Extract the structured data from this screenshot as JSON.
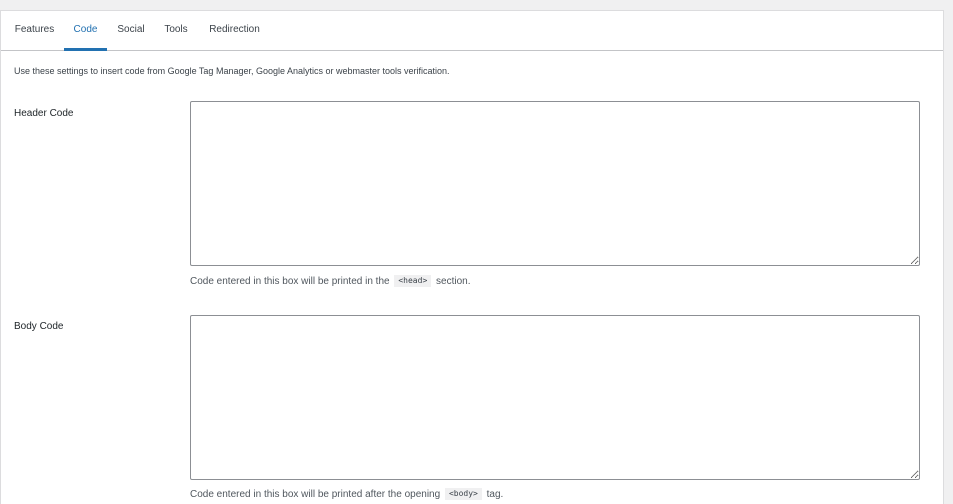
{
  "tabs": [
    {
      "label": "Features",
      "active": false
    },
    {
      "label": "Code",
      "active": true
    },
    {
      "label": "Social",
      "active": false
    },
    {
      "label": "Tools",
      "active": false
    },
    {
      "label": "Redirection",
      "active": false
    }
  ],
  "intro_text": "Use these settings to insert code from Google Tag Manager, Google Analytics or webmaster tools verification.",
  "header_code": {
    "label": "Header Code",
    "value": "",
    "description_before": "Code entered in this box will be printed in the",
    "tag": "<head>",
    "description_after": "section."
  },
  "body_code": {
    "label": "Body Code",
    "value": "",
    "description_before": "Code entered in this box will be printed after the opening",
    "tag": "<body>",
    "description_after": "tag."
  },
  "colors": {
    "accent": "#2271b1",
    "border": "#c3c4c7",
    "text": "#1d2327"
  }
}
